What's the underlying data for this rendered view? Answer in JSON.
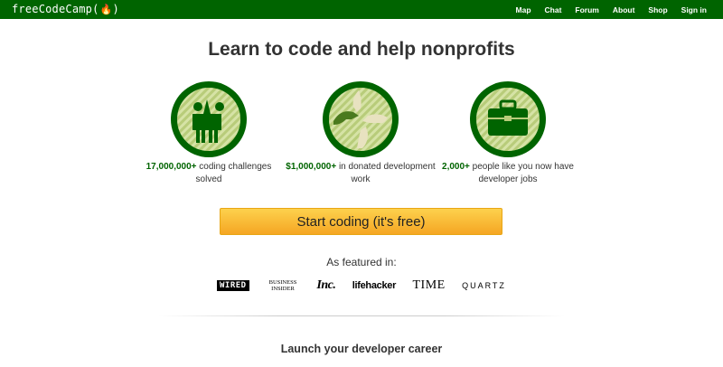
{
  "nav": {
    "brand": "freeCodeCamp(",
    "brand_suffix": ")",
    "links": [
      "Map",
      "Chat",
      "Forum",
      "About",
      "Shop",
      "Sign in"
    ]
  },
  "hero": {
    "title": "Learn to code and help nonprofits"
  },
  "features": [
    {
      "icon": "high-five-icon",
      "highlight": "17,000,000+",
      "text": " coding challenges solved"
    },
    {
      "icon": "helping-hands-icon",
      "highlight": "$1,000,000+",
      "text": " in donated development work"
    },
    {
      "icon": "briefcase-icon",
      "highlight": "2,000+",
      "text": " people like you now have developer jobs"
    }
  ],
  "cta": {
    "label": "Start coding (it's free)"
  },
  "featured": {
    "label": "As featured in:",
    "logos": [
      "WIRED",
      "BUSINESS INSIDER",
      "Inc.",
      "lifehacker",
      "TIME",
      "QUARTZ"
    ]
  },
  "section": {
    "title": "Launch your developer career"
  },
  "colors": {
    "brand_green": "#006400",
    "icon_light": "#c8d98c",
    "cta_top": "#fdd14d",
    "cta_bottom": "#f5a623"
  }
}
